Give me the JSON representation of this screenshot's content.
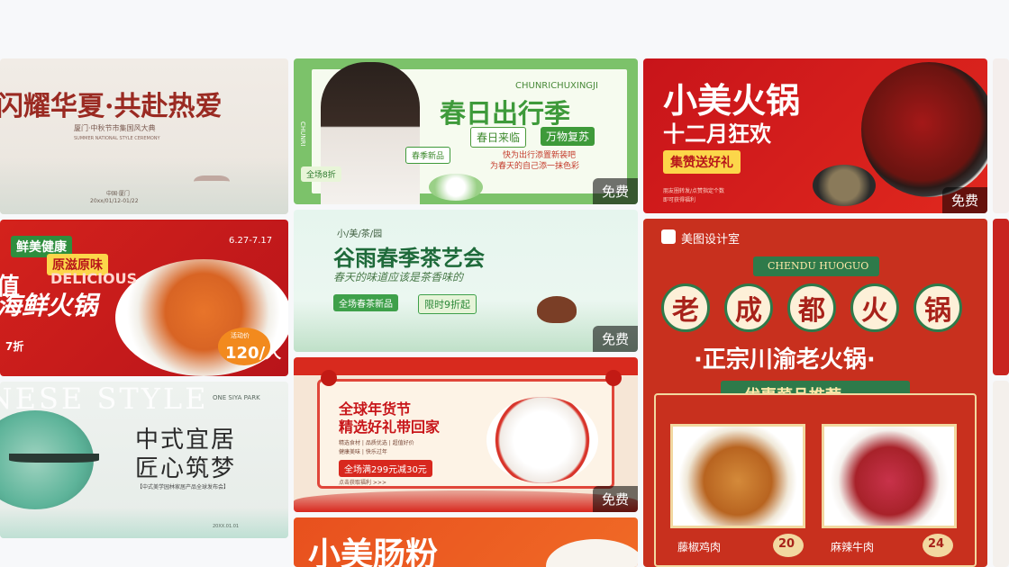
{
  "badge": {
    "free": "免费"
  },
  "cards": [
    {
      "title": "闪耀华夏·共赴热爱",
      "subtitle": "厦门·中秋节市集国风大典",
      "english": "SUMMER NATIONAL STYLE CEREMONY",
      "location": "中国·厦门",
      "date": "20xx/01/12-01/22"
    },
    {
      "side_text": "CHUNRI",
      "english": "CHUNRICHUXINGJI",
      "title": "春日出行季",
      "tag1": "春日来临",
      "tag2": "万物复苏",
      "tag3": "春季新品",
      "desc1": "快为出行添置新装吧",
      "desc2": "为春天的自己添一抹色彩",
      "tag4": "全场8折"
    },
    {
      "title": "小美火锅",
      "subtitle": "十二月狂欢",
      "tag": "集赞送好礼",
      "desc1": "朋友圈转发/点赞指定个数",
      "desc2": "即可获得福利"
    },
    {},
    {
      "tag1": "鲜美健康",
      "tag2": "原滋原味",
      "date_range": "6.27-7.17",
      "big1": "值",
      "english": "DELICIOUS",
      "title": "海鲜火锅",
      "discount": "7折",
      "price_label": "活动价",
      "price": "120/人"
    },
    {
      "brand": "小/美/茶/园",
      "title": "谷雨春季茶艺会",
      "subtitle": "春天的味道应该是茶香味的",
      "tag1": "全场春茶新品",
      "tag2": "限时9折起"
    },
    {
      "brand": "美图设计室",
      "ribbon": "CHENDU HUOGUO",
      "title_chars": [
        "老",
        "成",
        "都",
        "火",
        "锅"
      ],
      "subtitle": "·正宗川渝老火锅·",
      "section": "优惠菜品推荐",
      "dish1": "藤椒鸡肉",
      "price1": "20",
      "dish2": "麻辣牛肉",
      "price2": "24"
    },
    {
      "english": "INESE STYLE",
      "brand": "ONE SIYA PARK",
      "title1": "中式宜居",
      "title2": "匠心筑梦",
      "desc": "【中式美学园林家居产品全球发布会】",
      "footer": "20XX.01.01"
    },
    {
      "title1": "全球年货节",
      "title2": "精选好礼带回家",
      "desc1": "精选食材 | 品质优选 | 超值好价",
      "desc2": "健康美味 | 快乐过年",
      "tag": "全场满299元减30元",
      "note": "点击获取福利 >>>"
    },
    {
      "title": "小美肠粉"
    }
  ],
  "colors": {
    "page_bg": "#f7f8fa",
    "hotpot_red": "#c8141a",
    "spring_green": "#7cc26a",
    "tea_green": "#1e6a3a",
    "chengdu_red": "#c8301e",
    "chengdu_green": "#2e7a4a"
  }
}
